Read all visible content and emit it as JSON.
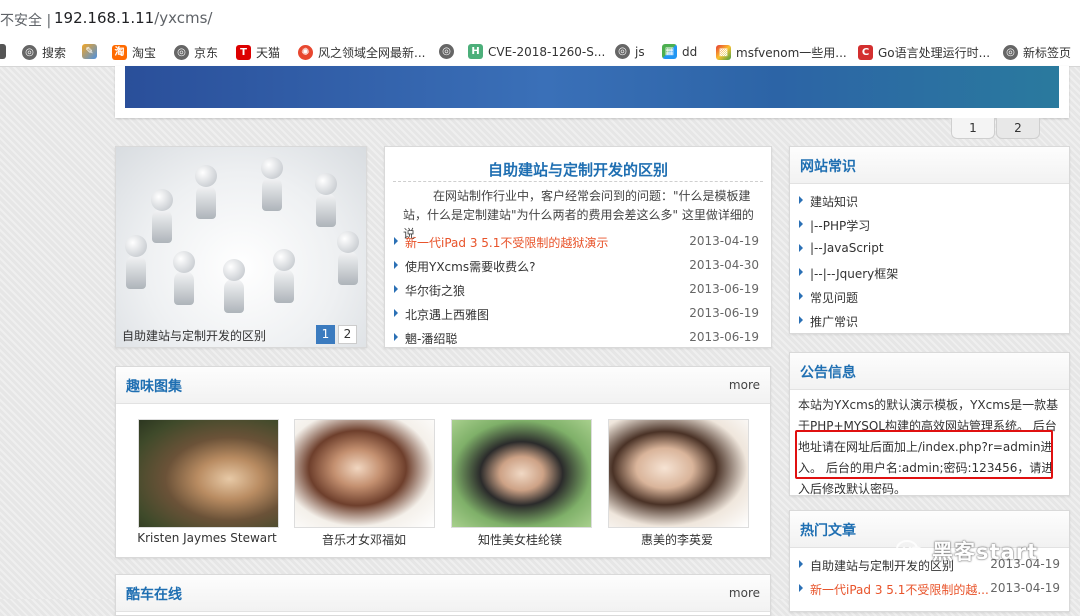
{
  "browser": {
    "security_label": "不安全 |",
    "url_host": "192.168.1.11",
    "url_path": "/yxcms/",
    "bookmarks": [
      {
        "label": "搜索",
        "icon": "globe-icon"
      },
      {
        "label": "淘宝",
        "icon": "taobao-icon"
      },
      {
        "label": "京东",
        "icon": "globe-icon"
      },
      {
        "label": "天猫",
        "icon": "tmall-icon"
      },
      {
        "label": "风之领域全网最新...",
        "icon": "wind-icon"
      },
      {
        "label": "CVE-2018-1260-S...",
        "icon": "h-icon"
      },
      {
        "label": "js",
        "icon": "globe-icon"
      },
      {
        "label": "dd",
        "icon": "puzzle-icon"
      },
      {
        "label": "msfvenom一些用...",
        "icon": "grid-icon"
      },
      {
        "label": "Go语言处理运行时...",
        "icon": "c-icon"
      },
      {
        "label": "新标签页",
        "icon": "globe-icon"
      }
    ]
  },
  "banner_pager": [
    "1",
    "2"
  ],
  "slideshow": {
    "caption": "自助建站与定制开发的区别",
    "pages": [
      "1",
      "2"
    ],
    "active_page": "1"
  },
  "article": {
    "title": "自助建站与定制开发的区别",
    "intro": "在网站制作行业中，客户经常会问到的问题：\"什么是模板建站，什么是定制建站\"为什么两者的费用会差这么多\" 这里做详细的说",
    "news": [
      {
        "title": "新一代iPad 3 5.1不受限制的越狱演示",
        "date": "2013-04-19",
        "hot": true
      },
      {
        "title": "使用YXcms需要收费么?",
        "date": "2013-04-30",
        "hot": false
      },
      {
        "title": "华尔街之狼",
        "date": "2013-06-19",
        "hot": false
      },
      {
        "title": "北京遇上西雅图",
        "date": "2013-06-19",
        "hot": false
      },
      {
        "title": "魍-潘绍聪",
        "date": "2013-06-19",
        "hot": false
      }
    ]
  },
  "gallery": {
    "title": "趣味图集",
    "more": "more",
    "photos": [
      {
        "caption": "Kristen Jaymes Stewart"
      },
      {
        "caption": "音乐才女邓福如"
      },
      {
        "caption": "知性美女桂纶镁"
      },
      {
        "caption": "惠美的李英爱"
      }
    ]
  },
  "car_section": {
    "title": "酷车在线",
    "more": "more"
  },
  "site_tips": {
    "title": "网站常识",
    "items": [
      "建站知识",
      "|--PHP学习",
      "|--JavaScript",
      "|--|--Jquery框架",
      "常见问题",
      "推广常识"
    ]
  },
  "notice": {
    "title": "公告信息",
    "text": "本站为YXcms的默认演示模板，YXcms是一款基于PHP+MYSQL构建的高效网站管理系统。 后台地址请在网址后面加上/index.php?r=admin进入。 后台的用户名:admin;密码:123456，请进入后修改默认密码。",
    "highlight_color": "#e01010"
  },
  "hot_articles": {
    "title": "热门文章",
    "items": [
      {
        "title": "自助建站与定制开发的区别",
        "date": "2013-04-19",
        "hot": false
      },
      {
        "title": "新一代iPad 3 5.1不受限制的越...",
        "date": "2013-04-19",
        "hot": true
      }
    ]
  },
  "watermark": {
    "text": "黑客start"
  },
  "colors": {
    "accent": "#1f6fb2",
    "hot_link": "#e8532a",
    "active_page": "#3b7bbf"
  }
}
